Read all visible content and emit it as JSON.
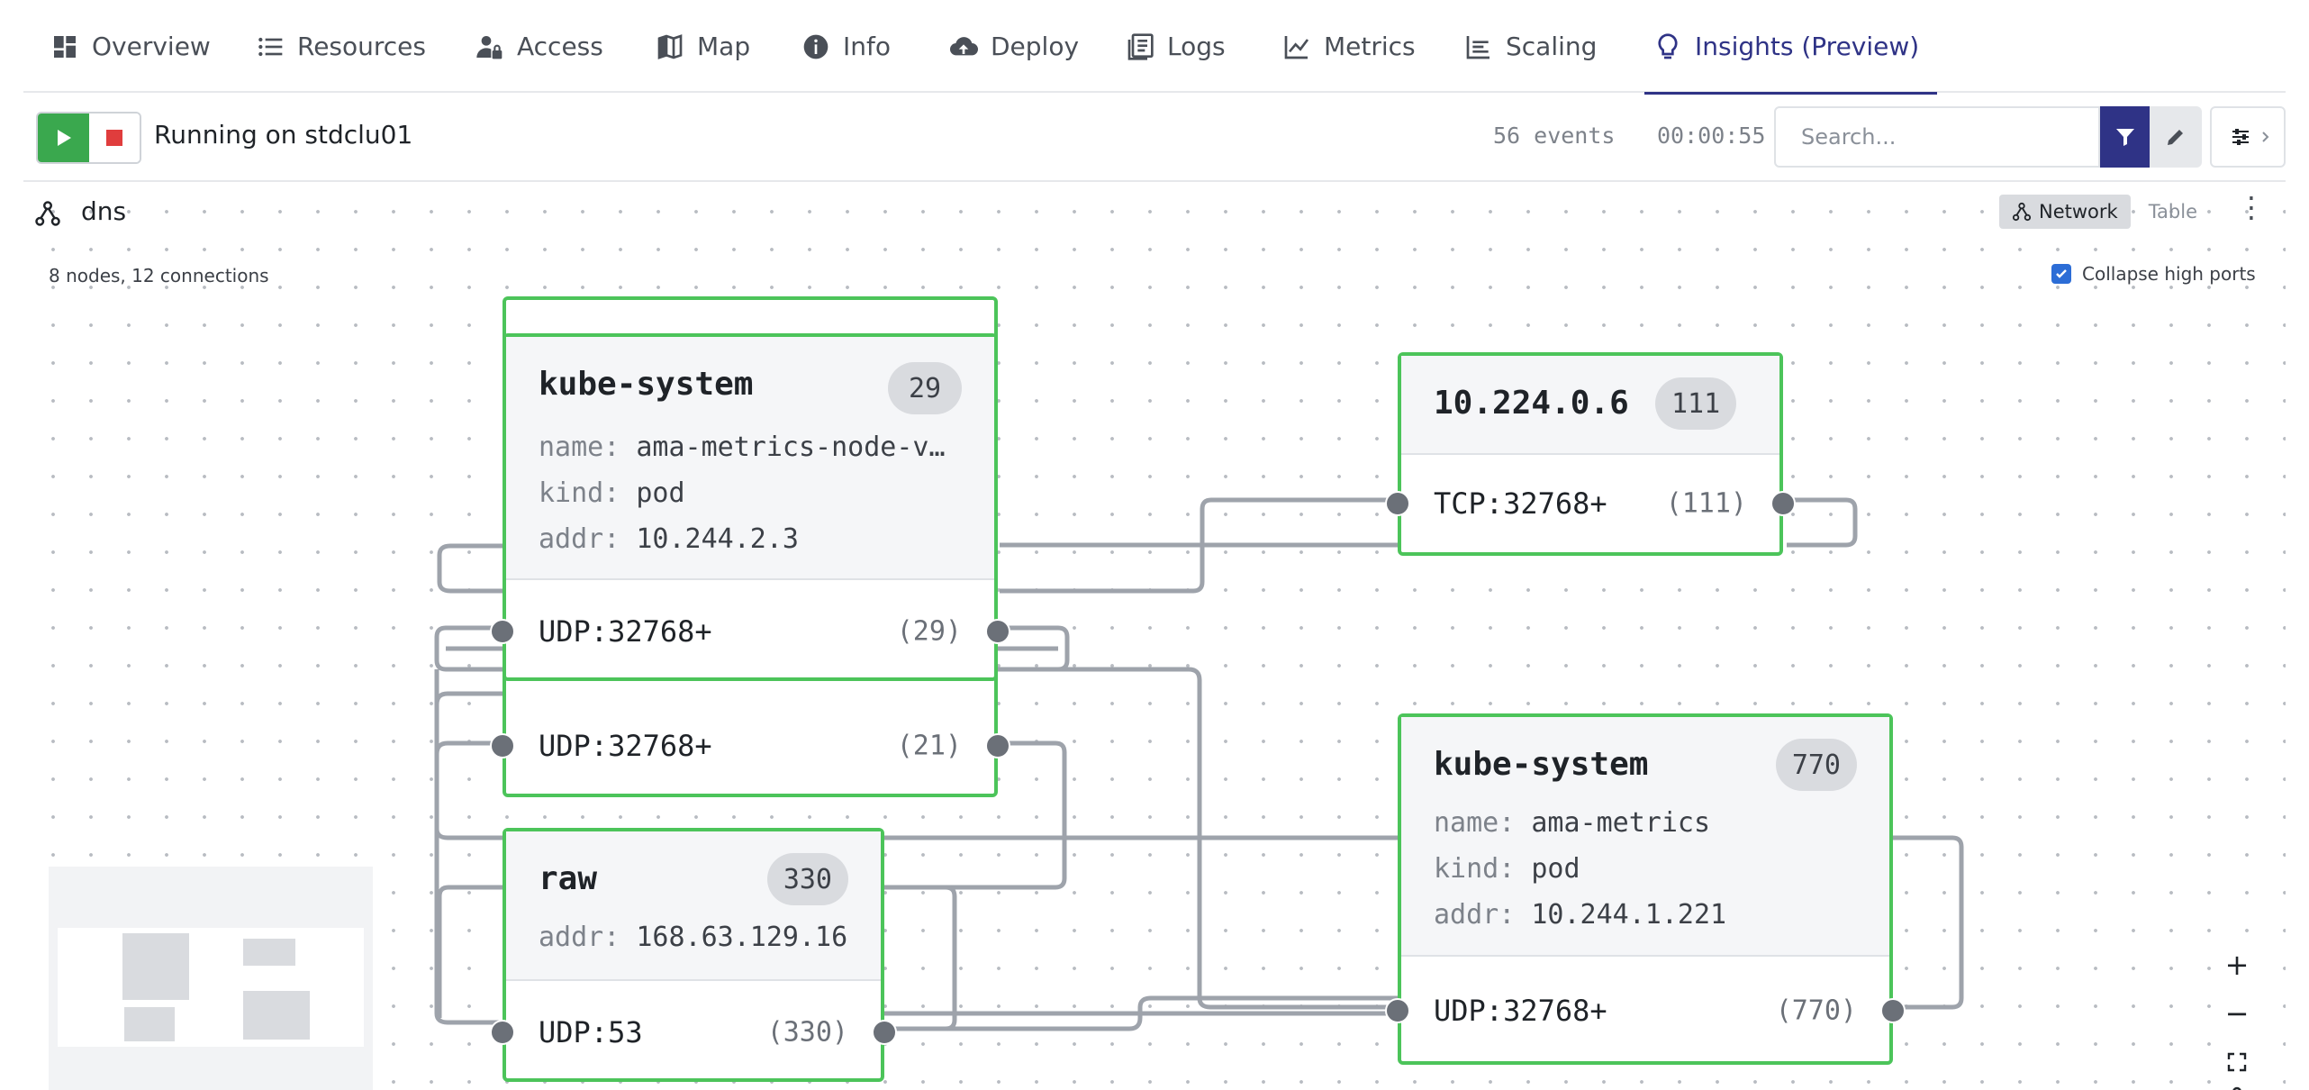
{
  "tabs": [
    {
      "label": "Overview",
      "icon": "dashboard-icon"
    },
    {
      "label": "Resources",
      "icon": "list-icon"
    },
    {
      "label": "Access",
      "icon": "user-lock-icon"
    },
    {
      "label": "Map",
      "icon": "map-icon"
    },
    {
      "label": "Info",
      "icon": "info-icon"
    },
    {
      "label": "Deploy",
      "icon": "cloud-upload-icon"
    },
    {
      "label": "Logs",
      "icon": "logs-icon"
    },
    {
      "label": "Metrics",
      "icon": "chart-line-icon"
    },
    {
      "label": "Scaling",
      "icon": "scaling-icon"
    },
    {
      "label": "Insights (Preview)",
      "icon": "lightbulb-icon",
      "active": true
    }
  ],
  "toolbar": {
    "status": "Running on stdclu01",
    "events": "56 events",
    "elapsed": "00:00:55",
    "search_placeholder": "Search..."
  },
  "panel": {
    "title": "dns",
    "view_network": "Network",
    "view_table": "Table",
    "active_view": "Network",
    "summary": "8 nodes, 12 connections",
    "collapse_label": "Collapse high ports",
    "collapse_checked": true
  },
  "nodes": {
    "kube_system_29": {
      "title": "kube-system",
      "count": "29",
      "name_key": "name:",
      "name_val": "ama-metrics-node-v…",
      "kind_key": "kind:",
      "kind_val": "pod",
      "addr_key": "addr:",
      "addr_val": "10.244.2.3",
      "port1": "UDP:32768+",
      "port1_count": "(29)",
      "port2": "UDP:32768+",
      "port2_count": "(21)"
    },
    "ip_10_224_0_6": {
      "title": "10.224.0.6",
      "count": "111",
      "port1": "TCP:32768+",
      "port1_count": "(111)"
    },
    "kube_system_770": {
      "title": "kube-system",
      "count": "770",
      "name_key": "name:",
      "name_val": "ama-metrics",
      "kind_key": "kind:",
      "kind_val": "pod",
      "addr_key": "addr:",
      "addr_val": "10.244.1.221",
      "port1": "UDP:32768+",
      "port1_count": "(770)"
    },
    "raw_330": {
      "title": "raw",
      "count": "330",
      "addr_key": "addr:",
      "addr_val": "168.63.129.16",
      "port1": "UDP:53",
      "port1_count": "(330)"
    }
  },
  "zoom": {
    "in": "+",
    "out": "−"
  },
  "colors": {
    "accent": "#2f3386",
    "node_border": "#4cc45a",
    "play": "#3aa84e",
    "stop": "#e03d3d",
    "edge": "#9ea3ab",
    "port_dot": "#6b7078"
  }
}
